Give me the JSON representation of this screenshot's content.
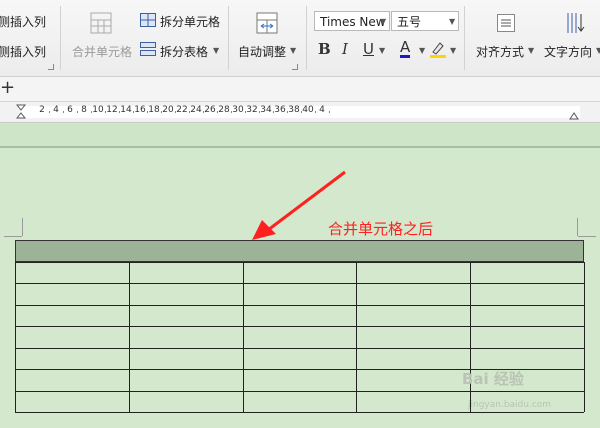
{
  "toolbar": {
    "insert_left_col": "左侧插入列",
    "insert_right_col": "右侧插入列",
    "merge_cells": "合并单元格",
    "split_cells": "拆分单元格",
    "split_table": "拆分表格",
    "auto_fit": "自动调整",
    "font_name": "Times New",
    "font_size": "五号",
    "bold": "B",
    "italic": "I",
    "underline": "U",
    "font_color_letter": "A",
    "align": "对齐方式",
    "text_direction": "文字方向"
  },
  "tabbar": {
    "add_label": "+"
  },
  "ruler": {
    "ticks": [
      "2",
      "4",
      "6",
      "8",
      "10",
      "12",
      "14",
      "16",
      "18",
      "20",
      "22",
      "24",
      "26",
      "28",
      "30",
      "32",
      "34",
      "36",
      "38",
      "40",
      "4"
    ]
  },
  "annotation": {
    "text": "合并单元格之后",
    "color": "#ff2020"
  },
  "table": {
    "merged_row_color": "#9cb398",
    "rows": 7,
    "cols": 5
  },
  "watermark": {
    "brand": "Bai 经验",
    "url": "jingyan.baidu.com"
  },
  "colors": {
    "page_bg": "#d3e8cc",
    "accent_red": "#ff2020"
  }
}
